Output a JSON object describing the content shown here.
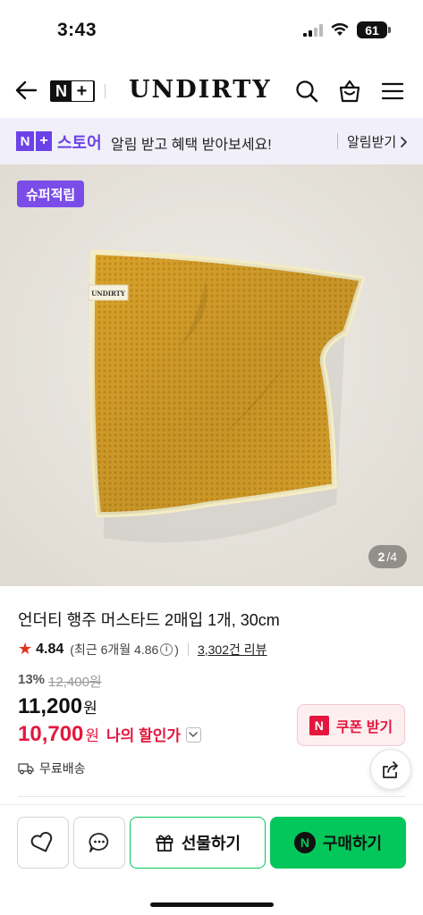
{
  "status_bar": {
    "time": "3:43",
    "battery": "61"
  },
  "header": {
    "logo_n": "N",
    "logo_plus": "+",
    "brand": "UNDIRTY",
    "icons": [
      "back-arrow-icon",
      "search-icon",
      "shopping-bag-icon",
      "menu-icon"
    ]
  },
  "store_banner": {
    "badge_n": "N",
    "badge_plus": "+",
    "store_name": "스토어",
    "message": "알림 받고 혜택 받아보세요!",
    "cta": "알림받기"
  },
  "product_image": {
    "badge": "슈퍼적립",
    "label_text": "UNDIRTY",
    "counter_current": "2",
    "counter_total": "/4",
    "towel_color": "#d9a52e"
  },
  "product": {
    "title": "언더티 행주 머스타드 2매입 1개, 30cm",
    "rating": "4.84",
    "recent_rating": "(최근 6개월 4.86",
    "recent_rating_close": ")",
    "reviews": "3,302건 리뷰",
    "discount_pct": "13%",
    "original_price": "12,400원",
    "price": "11,200",
    "price_unit": "원",
    "my_price": "10,700",
    "my_price_unit": "원",
    "my_price_label": "나의 할인가",
    "coupon_badge": "N",
    "coupon_label": "쿠폰 받기",
    "shipping": "무료배송"
  },
  "bottom_bar": {
    "gift_label": "선물하기",
    "buy_badge": "N",
    "buy_label": "구매하기"
  },
  "colors": {
    "accent_purple": "#6b42e8",
    "sale_red": "#e3173e",
    "naver_green": "#03c75a"
  }
}
